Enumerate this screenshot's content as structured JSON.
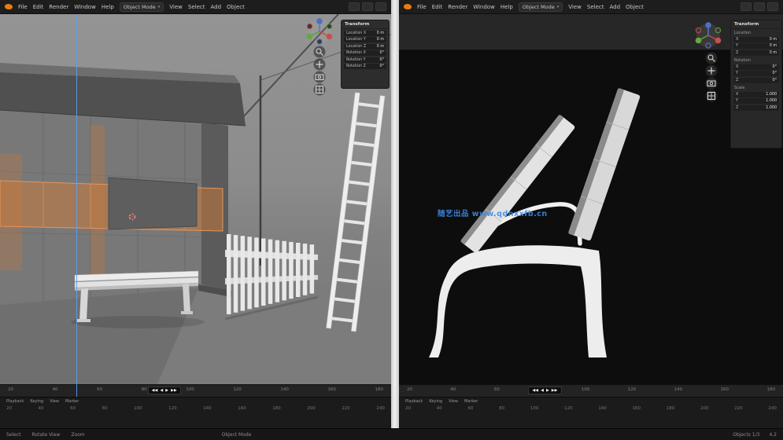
{
  "watermark": {
    "text": "随艺出品 www.qdnxxfb.cn"
  },
  "header": {
    "menus": [
      "File",
      "Edit",
      "Render",
      "Window",
      "Help"
    ],
    "view_menus": [
      "View",
      "Select",
      "Add",
      "Object"
    ],
    "mode": "Object Mode"
  },
  "left_npanel": {
    "title": "Transform",
    "rows": [
      {
        "label": "Location X",
        "value": "0 m"
      },
      {
        "label": "Location Y",
        "value": "0 m"
      },
      {
        "label": "Location Z",
        "value": "0 m"
      },
      {
        "label": "Rotation X",
        "value": "0°"
      },
      {
        "label": "Rotation Y",
        "value": "0°"
      },
      {
        "label": "Rotation Z",
        "value": "0°"
      }
    ]
  },
  "right_npanel": {
    "title": "Transform",
    "sections": [
      {
        "label": "Location",
        "rows": [
          {
            "axis": "X",
            "value": "0 m"
          },
          {
            "axis": "Y",
            "value": "0 m"
          },
          {
            "axis": "Z",
            "value": "0 m"
          }
        ]
      },
      {
        "label": "Rotation",
        "rows": [
          {
            "axis": "X",
            "value": "0°"
          },
          {
            "axis": "Y",
            "value": "0°"
          },
          {
            "axis": "Z",
            "value": "0°"
          }
        ]
      },
      {
        "label": "Scale",
        "rows": [
          {
            "axis": "X",
            "value": "1.000"
          },
          {
            "axis": "Y",
            "value": "1.000"
          },
          {
            "axis": "Z",
            "value": "1.000"
          }
        ]
      }
    ]
  },
  "timeline": {
    "row1_ticks": [
      "20",
      "40",
      "60",
      "80",
      "100",
      "120",
      "140",
      "160",
      "180"
    ],
    "row2_ticks": [
      "20",
      "40",
      "60",
      "80",
      "100",
      "120",
      "140",
      "160",
      "180",
      "200",
      "220",
      "240"
    ],
    "menus": [
      "Playback",
      "Keying",
      "View",
      "Marker"
    ],
    "playback": [
      "◀◀",
      "◀",
      "▶",
      "▶▶"
    ]
  },
  "statusbar": {
    "left_items": [
      "Select",
      "Rotate View",
      "Zoom"
    ],
    "mid_items": [
      "Object Mode"
    ],
    "right_items": [
      "Objects 1/3",
      "4.2"
    ]
  }
}
